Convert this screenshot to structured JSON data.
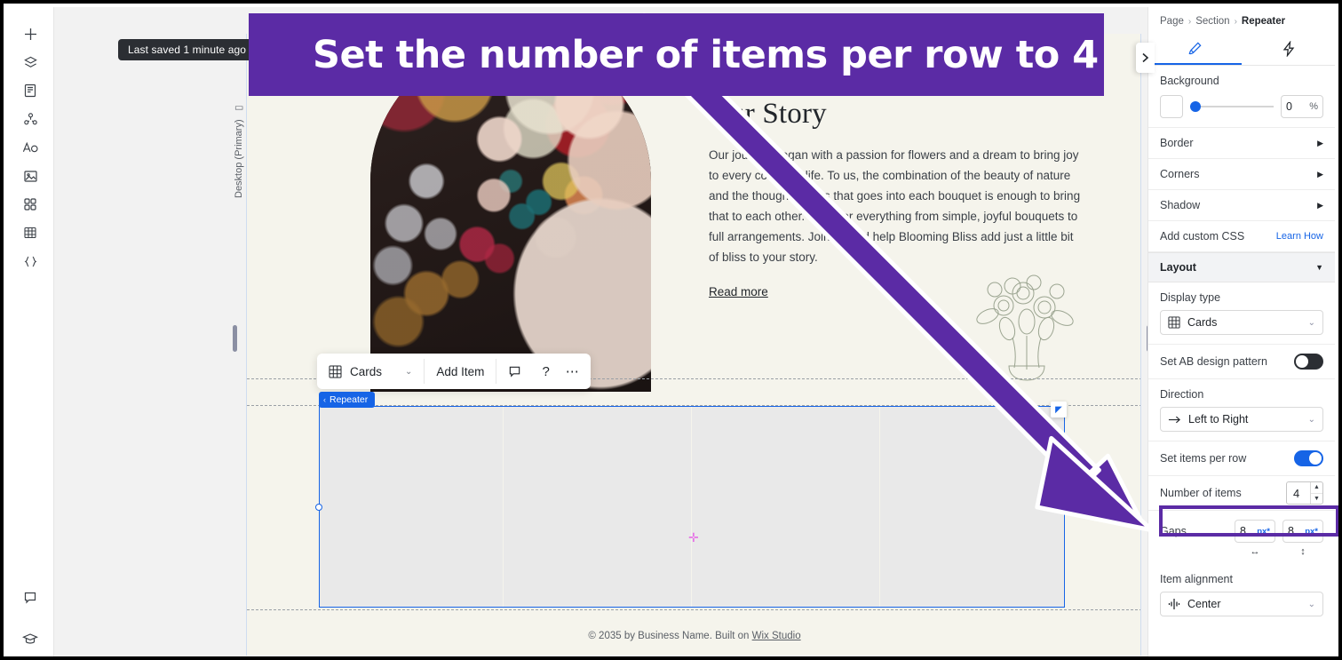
{
  "annotation": {
    "banner_text": "Set the number of items per row to 4",
    "accent_color": "#5b2ba5",
    "highlight_target": "number-of-items-field"
  },
  "toast": {
    "text": "Last saved 1 minute ago"
  },
  "left_rail": {
    "items": [
      {
        "name": "add-element-icon",
        "label": "Add"
      },
      {
        "name": "layers-icon",
        "label": "Layers"
      },
      {
        "name": "pages-icon",
        "label": "Pages"
      },
      {
        "name": "cms-icon",
        "label": "CMS"
      },
      {
        "name": "text-style-icon",
        "label": "Text & Theme"
      },
      {
        "name": "media-icon",
        "label": "Media"
      },
      {
        "name": "apps-icon",
        "label": "Apps"
      },
      {
        "name": "table-icon",
        "label": "Table"
      },
      {
        "name": "code-icon",
        "label": "Dev Mode"
      }
    ],
    "bottom_items": [
      {
        "name": "comments-icon",
        "label": "Comments"
      },
      {
        "name": "learn-icon",
        "label": "Learn"
      }
    ]
  },
  "canvas": {
    "orientation_label": "Desktop (Primary)",
    "story": {
      "heading": "Our Story",
      "body": "Our journey began with a passion for flowers and a dream to bring joy to every corner of life. To us, the combination of the beauty of nature and the thoughtfulness that goes into each bouquet is enough to bring that to each other. We offer everything from simple, joyful bouquets to full arrangements. Join us and help Blooming Bliss add just a little bit of bliss to your story.",
      "read_more": "Read more"
    },
    "element_toolbar": {
      "display_type": "Cards",
      "add_item": "Add Item",
      "comment_icon": "comment-icon",
      "help_icon": "help-icon",
      "more_icon": "more-options-icon"
    },
    "repeater_tag": "Repeater",
    "repeater_columns": 4,
    "footer": {
      "text": "© 2035 by Business Name. Built on ",
      "link": "Wix Studio"
    }
  },
  "right_panel": {
    "breadcrumb": {
      "level1": "Page",
      "level2": "Section",
      "current": "Repeater"
    },
    "tabs": [
      {
        "name": "design-tab",
        "icon": "brush-icon",
        "active": true
      },
      {
        "name": "interactions-tab",
        "icon": "lightning-icon",
        "active": false
      }
    ],
    "background": {
      "label": "Background",
      "opacity_value": "0",
      "opacity_unit": "%",
      "swatch_color": "#ffffff"
    },
    "sections": [
      {
        "label": "Border",
        "name": "border-section"
      },
      {
        "label": "Corners",
        "name": "corners-section"
      },
      {
        "label": "Shadow",
        "name": "shadow-section"
      }
    ],
    "custom_css": {
      "label": "Add custom CSS",
      "link": "Learn How"
    },
    "layout": {
      "title": "Layout",
      "display_type": {
        "label": "Display type",
        "value": "Cards"
      },
      "ab_pattern": {
        "label": "Set AB design pattern",
        "on": false
      },
      "direction": {
        "label": "Direction",
        "value": "Left to Right"
      },
      "items_per_row": {
        "label": "Set items per row",
        "on": true
      },
      "number_of_items": {
        "label": "Number of items",
        "value": "4"
      },
      "gaps": {
        "label": "Gaps",
        "horizontal": "8",
        "vertical": "8",
        "unit": "px*"
      },
      "item_alignment": {
        "label": "Item alignment",
        "value": "Center"
      }
    }
  }
}
